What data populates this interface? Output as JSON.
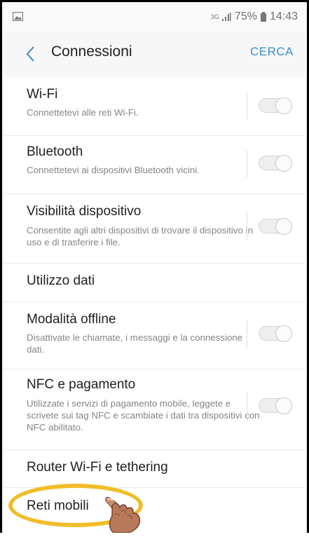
{
  "status": {
    "network": "3G",
    "battery": "75%",
    "time": "14:43"
  },
  "header": {
    "title": "Connessioni",
    "action": "CERCA"
  },
  "items": [
    {
      "title": "Wi-Fi",
      "desc": "Connettetevi alle reti Wi-Fi.",
      "toggle": false
    },
    {
      "title": "Bluetooth",
      "desc": "Connettetevi ai dispositivi Bluetooth vicini.",
      "toggle": false
    },
    {
      "title": "Visibilità dispositivo",
      "desc": "Consentite agli altri dispositivi di trovare il dispositivo in uso e di trasferire i file.",
      "toggle": false
    },
    {
      "title": "Utilizzo dati"
    },
    {
      "title": "Modalità offline",
      "desc": "Disattivate le chiamate, i messaggi e la connessione dati.",
      "toggle": false
    },
    {
      "title": "NFC e pagamento",
      "desc": "Utilizzate i servizi di pagamento mobile, leggete e scrivete sui tag NFC e scambiate i dati tra dispositivi con NFC abilitato.",
      "toggle": false
    },
    {
      "title": "Router Wi-Fi e tethering"
    },
    {
      "title": "Reti mobili"
    }
  ],
  "colors": {
    "accent": "#3d8ec7",
    "highlight": "#f0bd2a"
  },
  "icons": [
    "gallery-icon",
    "signal-icon",
    "battery-icon",
    "back-arrow-icon",
    "pointing-hand-icon"
  ]
}
